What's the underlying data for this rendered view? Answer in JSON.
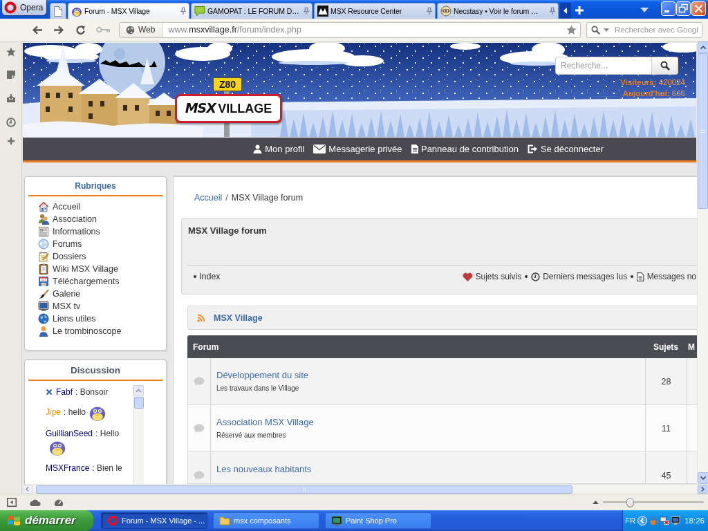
{
  "browser": {
    "menu_button": "Opera",
    "tabs": [
      {
        "title": "Forum - MSX Village",
        "selected": true
      },
      {
        "title": "GAMOPAT : LE FORUM D…",
        "selected": false
      },
      {
        "title": "MSX Resource Center",
        "selected": false
      },
      {
        "title": "Necstasy • Voir le forum …",
        "selected": false
      }
    ],
    "address": {
      "site_button": "Web",
      "url_prefix": "www.",
      "url_domain": "msxvillage.fr",
      "url_path": "/forum/index.php"
    },
    "search": {
      "placeholder": "Rechercher avec Googl"
    },
    "zoom": {
      "level": 0.27
    }
  },
  "site": {
    "logo": {
      "chip": "Z80",
      "brand": "MSX",
      "name": "VILLAGE"
    },
    "search": {
      "placeholder": "Recherche..."
    },
    "stats": [
      "**Visiteurs:** 420024",
      "**Aujourd'hui:** 666"
    ],
    "nav": [
      {
        "label": "Mon profil"
      },
      {
        "label": "Messagerie privée"
      },
      {
        "label": "Panneau de contribution"
      },
      {
        "label": "Se déconnecter"
      }
    ]
  },
  "sidebar": {
    "rubriques": {
      "title": "Rubriques",
      "items": [
        "Accueil",
        "Association",
        "Informations",
        "Forums",
        "Dossiers",
        "Wiki MSX Village",
        "Téléchargements",
        "Galerie",
        "MSX tv",
        "Liens utiles",
        "Le trombinoscope"
      ]
    },
    "discussion": {
      "title": "Discussion",
      "messages": [
        {
          "author": "Fabf",
          "color": "#000080",
          "text": ": Bonsoir",
          "deletable": true,
          "smiley": false
        },
        {
          "author": "Jipe",
          "color": "#f7941d",
          "text": ": hello",
          "deletable": false,
          "smiley": true
        },
        {
          "author": "GuillianSeed",
          "color": "#000080",
          "text": ": Hello",
          "deletable": false,
          "smiley": true
        },
        {
          "author": "MSXFrance",
          "color": "#000080",
          "text": ": Bien le",
          "deletable": false,
          "smiley": false
        }
      ]
    }
  },
  "main": {
    "breadcrumb": {
      "separator": "/",
      "items": [
        {
          "label": "Accueil",
          "current": false
        },
        {
          "label": "MSX Village forum",
          "current": true
        }
      ]
    },
    "header": {
      "title": "MSX Village forum",
      "index_link": "Index",
      "quick_links": [
        "Sujets suivis",
        "Derniers messages lus",
        "Messages no"
      ]
    },
    "category": {
      "title": "MSX Village"
    },
    "table": {
      "columns": [
        "Forum",
        "Sujets",
        "M"
      ],
      "rows": [
        {
          "name": "Développement du site",
          "description": "Les travaux dans le Village",
          "topics": "28"
        },
        {
          "name": "Association MSX Village",
          "description": "Réservé aux membres",
          "topics": "11"
        },
        {
          "name": "Les nouveaux habitants",
          "topics": "45"
        }
      ]
    }
  },
  "taskbar": {
    "start": "démarrer",
    "tasks": [
      {
        "label": "Forum - MSX Village - ...",
        "selected": true
      },
      {
        "label": "msx composants",
        "selected": false
      },
      {
        "label": "Paint Shop Pro",
        "selected": false
      }
    ],
    "language": "FR",
    "clock": "18:26"
  }
}
